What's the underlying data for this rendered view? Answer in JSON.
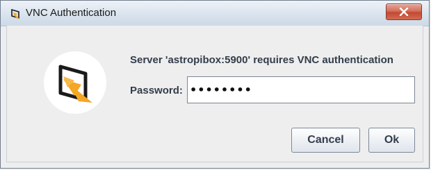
{
  "window": {
    "title": "VNC Authentication",
    "close_label": "close"
  },
  "dialog": {
    "message": "Server 'astropibox:5900' requires VNC authentication",
    "password_label": "Password:",
    "password_value": "••••••••",
    "cancel_label": "Cancel",
    "ok_label": "Ok"
  },
  "icons": {
    "app_icon": "vnc-logo-icon",
    "close_icon": "close-icon",
    "logo_large": "vnc-logo-icon"
  },
  "colors": {
    "logo_yellow": "#f5a623",
    "logo_outline": "#1a1a1a",
    "close_red": "#c24a33"
  }
}
